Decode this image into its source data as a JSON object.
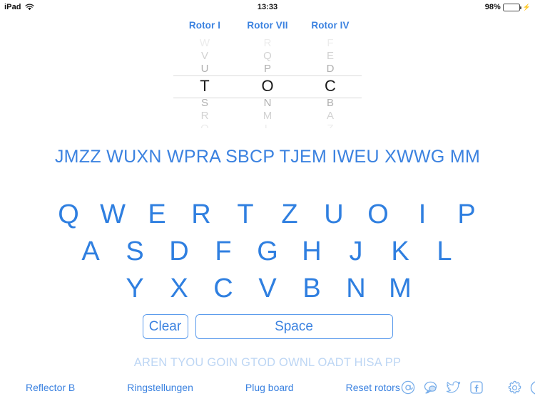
{
  "status_bar": {
    "device": "iPad",
    "wifi_icon": "wifi-icon",
    "time": "13:33",
    "battery_percent": "98%",
    "battery_level": 98,
    "battery_icon": "battery-icon",
    "charging_icon": "lightning-bolt-icon"
  },
  "rotors": [
    {
      "title": "Rotor I",
      "above": [
        "W",
        "V",
        "U"
      ],
      "selected": "T",
      "below": [
        "S",
        "R",
        "Q"
      ]
    },
    {
      "title": "Rotor VII",
      "above": [
        "R",
        "Q",
        "P"
      ],
      "selected": "O",
      "below": [
        "N",
        "M",
        "L"
      ]
    },
    {
      "title": "Rotor IV",
      "above": [
        "F",
        "E",
        "D"
      ],
      "selected": "C",
      "below": [
        "B",
        "A",
        "Z"
      ]
    }
  ],
  "cipher_output": "JMZZ WUXN WPRA SBCP TJEM IWEU XWWG MM",
  "plain_output": "AREN TYOU GOIN GTOD OWNL OADT HISA PP",
  "keyboard": {
    "row1": [
      "Q",
      "W",
      "E",
      "R",
      "T",
      "Z",
      "U",
      "O",
      "I",
      "P"
    ],
    "row2": [
      "A",
      "S",
      "D",
      "F",
      "G",
      "H",
      "J",
      "K",
      "L"
    ],
    "row3": [
      "Y",
      "X",
      "C",
      "V",
      "B",
      "N",
      "M"
    ]
  },
  "actions": {
    "clear_label": "Clear",
    "space_label": "Space"
  },
  "toolbar": {
    "links": [
      {
        "label": "Reflector B",
        "name": "reflector-button"
      },
      {
        "label": "Ringstellungen",
        "name": "ringstellungen-button"
      },
      {
        "label": "Plug board",
        "name": "plug-board-button"
      },
      {
        "label": "Reset rotors",
        "name": "reset-rotors-button"
      }
    ],
    "icons": [
      "email-icon",
      "message-bubble-icon",
      "twitter-icon",
      "facebook-icon",
      "gear-icon",
      "info-icon"
    ]
  },
  "colors": {
    "accent": "#3b82e0",
    "key": "#2f7fe0",
    "plain_text": "#bdd6f4",
    "rotor_dim": "#b8b8b8",
    "rotor_selected": "#1a1a1a",
    "battery_green": "#35c759",
    "icon_blue": "#79aeea"
  }
}
